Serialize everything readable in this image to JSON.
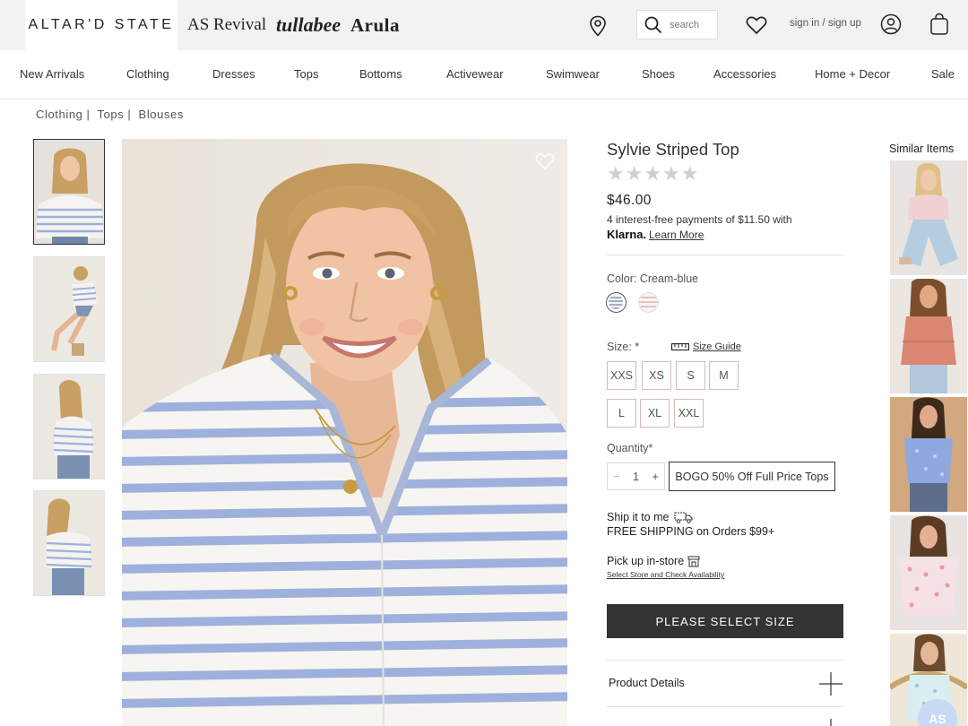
{
  "topbar": {
    "brands": [
      "ALTAR'D STATE",
      "AS Revival",
      "tullabee",
      "Arula"
    ],
    "search_placeholder": "search",
    "signin_label": "sign in / sign up",
    "icons": [
      "store-locator-icon",
      "search-icon",
      "heart-icon",
      "account-icon",
      "bag-icon"
    ]
  },
  "nav": {
    "items": [
      "New Arrivals",
      "Clothing",
      "Dresses",
      "Tops",
      "Bottoms",
      "Activewear",
      "Swimwear",
      "Shoes",
      "Accessories",
      "Home + Decor",
      "Sale"
    ]
  },
  "breadcrumb": [
    "Clothing",
    "Tops",
    "Blouses"
  ],
  "product": {
    "title": "Sylvie Striped Top",
    "rating_stars": "★★★★★",
    "rating_value": 0,
    "price": "$46.00",
    "installments": "4 interest-free payments of $11.50 with",
    "klarna": "Klarna.",
    "learn_more": "Learn More",
    "color_label": "Color: Cream-blue",
    "swatches": [
      {
        "name": "Cream-blue",
        "selected": true,
        "colors": [
          "#ffffff",
          "#a8b6d8"
        ]
      },
      {
        "name": "Cream-pink",
        "selected": false,
        "colors": [
          "#ffffff",
          "#e9c8cc"
        ]
      }
    ],
    "size_label": "Size: *",
    "size_guide": "Size Guide",
    "sizes": [
      "XXS",
      "XS",
      "S",
      "M",
      "L",
      "XL",
      "XXL"
    ],
    "quantity_label": "Quantity*",
    "quantity": {
      "minus": "−",
      "value": "1",
      "plus": "+"
    },
    "promo": "BOGO 50% Off Full Price Tops",
    "ship_title": "Ship it to me",
    "ship_sub": "FREE SHIPPING on Orders $99+",
    "pickup_title": "Pick up in-store",
    "pickup_link": "Select Store and Check Availability",
    "cta": "PLEASE SELECT SIZE",
    "accordions": [
      "Product Details",
      ""
    ]
  },
  "similar": {
    "title": "Similar Items"
  },
  "chat_badge": "AS",
  "colors": {
    "topbar_bg": "#f2f2f2",
    "cta_bg": "#333333",
    "stripe_blue": "#9fb0dc",
    "size_border": "#d9b8b8"
  }
}
